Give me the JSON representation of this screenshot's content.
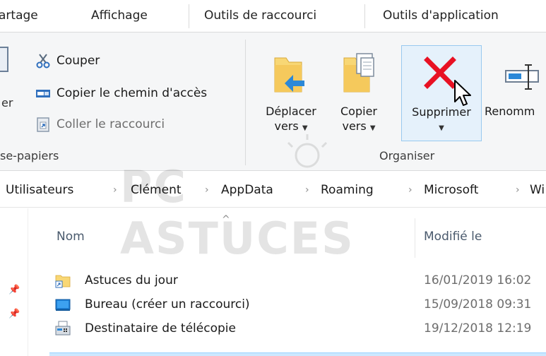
{
  "tabs": [
    "artage",
    "Affichage",
    "Outils de raccourci",
    "Outils d'application"
  ],
  "clipboard_group": {
    "label": "se-papiers",
    "partial_button_label": "er",
    "cut_label": "Couper",
    "copy_path_label": "Copier le chemin d'accès",
    "paste_shortcut_label": "Coller le raccourci"
  },
  "organise_group": {
    "label": "Organiser",
    "move_to": {
      "line1": "Déplacer",
      "line2": "vers"
    },
    "copy_to": {
      "line1": "Copier",
      "line2": "vers"
    },
    "delete_label": "Supprimer",
    "rename_label": "Renomm"
  },
  "breadcrumb": [
    "Utilisateurs",
    "Clément",
    "AppData",
    "Roaming",
    "Microsoft",
    "Wi"
  ],
  "columns": {
    "name": "Nom",
    "modified": "Modifié le"
  },
  "files": [
    {
      "name": "Astuces du jour",
      "date": "16/01/2019 16:02",
      "icon": "folder-shortcut-icon"
    },
    {
      "name": "Bureau (créer un raccourci)",
      "date": "15/09/2018 09:31",
      "icon": "desktop-icon"
    },
    {
      "name": "Destinataire de télécopie",
      "date": "19/12/2018 12:19",
      "icon": "fax-icon"
    }
  ],
  "watermark": "PC ASTUCES",
  "colors": {
    "ribbon_bg": "#f5f6f7",
    "hover_bg": "#e5f1fb",
    "hover_border": "#99c9ef",
    "delete_red": "#e81123",
    "folder_yellow": "#f8d775",
    "arrow_blue": "#2b88d8"
  }
}
